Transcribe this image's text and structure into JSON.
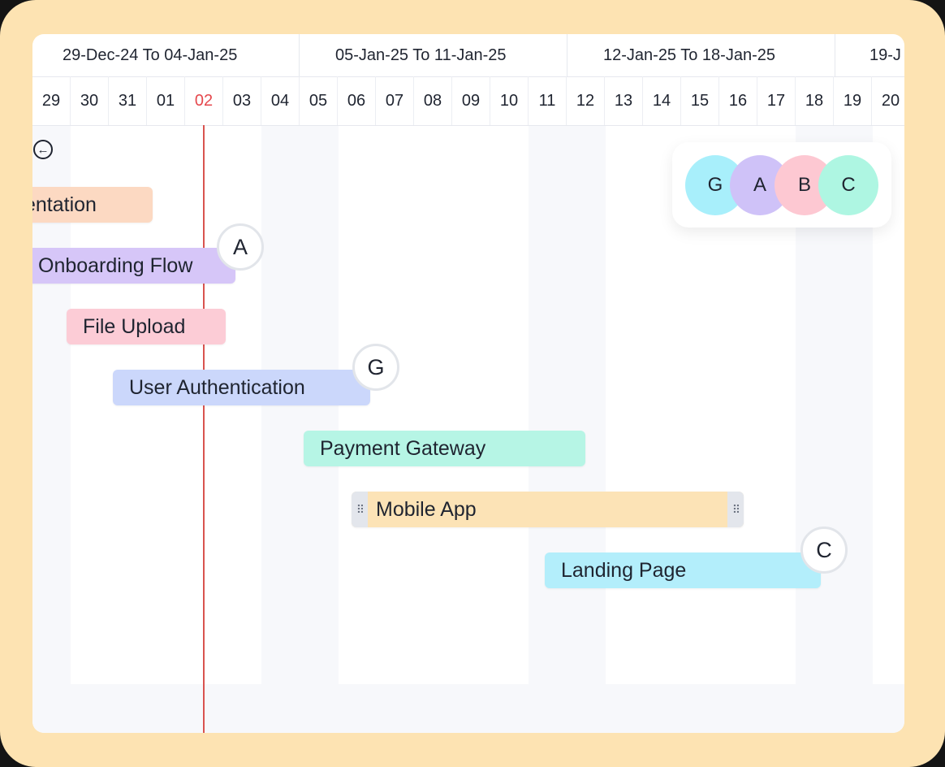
{
  "weeks": [
    {
      "label": "29-Dec-24 To 04-Jan-25"
    },
    {
      "label": "05-Jan-25 To 11-Jan-25"
    },
    {
      "label": "12-Jan-25 To 18-Jan-25"
    },
    {
      "label": "19-J"
    }
  ],
  "days": [
    "29",
    "30",
    "31",
    "01",
    "02",
    "03",
    "04",
    "05",
    "06",
    "07",
    "08",
    "09",
    "10",
    "11",
    "12",
    "13",
    "14",
    "15",
    "16",
    "17",
    "18",
    "19",
    "20"
  ],
  "today": "02",
  "back_icon": "arrow-left-circle-icon",
  "tasks": [
    {
      "name": "entation",
      "color": "#fcd9c2"
    },
    {
      "name": "Onboarding Flow",
      "color": "#d6c6f8",
      "assignee": "A"
    },
    {
      "name": "File Upload",
      "color": "#fcccd6"
    },
    {
      "name": "User Authentication",
      "color": "#cbd7fb",
      "assignee": "G"
    },
    {
      "name": "Payment Gateway",
      "color": "#b6f5e5"
    },
    {
      "name": "Mobile App",
      "color": "#fce3b6"
    },
    {
      "name": "Landing Page",
      "color": "#b3eefb",
      "assignee": "C"
    }
  ],
  "legend": [
    {
      "initial": "G",
      "color": "#a8effb"
    },
    {
      "initial": "A",
      "color": "#cfc2f8"
    },
    {
      "initial": "B",
      "color": "#fdc8d2"
    },
    {
      "initial": "C",
      "color": "#aef6e2"
    }
  ],
  "icons": {
    "drag_handle": "drag-handle-icon"
  }
}
